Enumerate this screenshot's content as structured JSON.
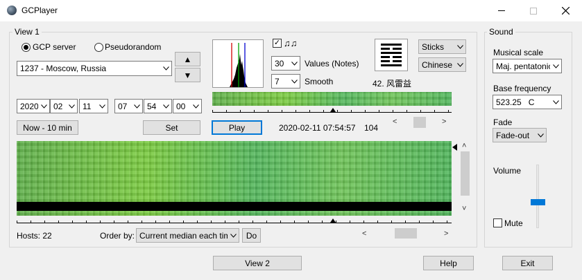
{
  "window": {
    "title": "GCPlayer"
  },
  "view1": {
    "group_label": "View 1",
    "source": {
      "gcp_label": "GCP server",
      "pseudo_label": "Pseudorandom",
      "selected": "gcp"
    },
    "location": "1237 - Moscow, Russia",
    "up_arrow": "▲",
    "down_arrow": "▼",
    "date": {
      "year": "2020",
      "month": "02",
      "day": "11",
      "hour": "07",
      "minute": "54",
      "second": "00"
    },
    "now_button": "Now - 10 min",
    "set_button": "Set",
    "play_button": "Play",
    "current_time": "2020-02-11 07:54:57",
    "count": "104",
    "notes_glyph": "♫♫",
    "notes_checked": true,
    "values_combo": "30",
    "values_label": "Values (Notes)",
    "smooth_combo": "7",
    "smooth_label": "Smooth",
    "hexagram_caption": "42. 风雷益",
    "display_combo": "Sticks",
    "language_combo": "Chinese",
    "hosts_text": "Hosts: 22",
    "order_label": "Order by:",
    "order_combo": "Current median each time",
    "do_button": "Do",
    "left_arrow": "<",
    "right_arrow": ">"
  },
  "sound": {
    "group_label": "Sound",
    "scale_label": "Musical scale",
    "scale_value": "Maj. pentatonic",
    "base_label": "Base frequency",
    "base_value": "523.25   C",
    "fade_label": "Fade",
    "fade_value": "Fade-out",
    "volume_label": "Volume",
    "volume_level": 0.4,
    "mute_label": "Mute",
    "mute_checked": false
  },
  "footer": {
    "view2_button": "View 2",
    "help_button": "Help",
    "exit_button": "Exit"
  },
  "colors": {
    "accent": "#0078d7",
    "histogram_red": "#d00000",
    "histogram_green": "#00a000",
    "histogram_blue": "#0000d0"
  },
  "icons": [
    "app-globe-icon",
    "minimize-icon",
    "maximize-icon",
    "close-icon",
    "music-notes-icon",
    "hexagram-icon",
    "chevron-down-icon"
  ]
}
